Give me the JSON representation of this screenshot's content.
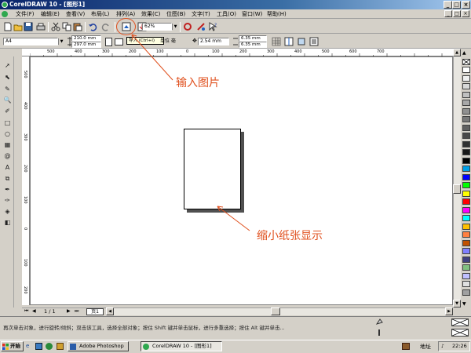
{
  "window": {
    "title": "CorelDRAW 10 - [图形1]",
    "min": "_",
    "max": "□",
    "close": "×",
    "doc_min": "_",
    "doc_max": "□",
    "doc_close": "×"
  },
  "menu": [
    "文件(F)",
    "编辑(E)",
    "查看(V)",
    "布局(L)",
    "排列(A)",
    "效果(C)",
    "位图(B)",
    "文字(T)",
    "工具(O)",
    "窗口(W)",
    "帮助(H)"
  ],
  "toolbar": {
    "zoom": "62%"
  },
  "property_bar": {
    "page_size": "A4",
    "width": "210.0 mm",
    "height": "297.0 mm",
    "units": "单位 毫米",
    "nudge": "2.54 mm",
    "dup_x": "6.35 mm",
    "dup_y": "6.35 mm"
  },
  "tooltip": "导入 (Ctrl+I)",
  "ruler_h": [
    "500",
    "400",
    "300",
    "200",
    "100",
    "0",
    "100",
    "200",
    "300",
    "400",
    "500",
    "600",
    "700"
  ],
  "ruler_v": [
    "500",
    "400",
    "300",
    "200",
    "100",
    "0",
    "100",
    "200"
  ],
  "page_nav": {
    "pos": "1 / 1",
    "tab": "页1"
  },
  "status": {
    "hint": "再次单击对象，进行旋转/倾斜；双击该工具，选择全部对象；按住 Shift 键并单击鼠标，进行多重选择；按住 Alt 键并单击..."
  },
  "annotations": {
    "import_label": "输入图片",
    "shrink_label": "缩小纸张显示"
  },
  "taskbar": {
    "start": "开始",
    "photoshop": "Adobe Photoshop",
    "corel": "CorelDRAW 10 - [图形1]",
    "address": "地址",
    "clock": "22:26"
  },
  "colors": {
    "accent": "#e0501e",
    "palette": [
      "#ffffff",
      "#f0f0f0",
      "#d8d8d8",
      "#c0c0c0",
      "#a8a8a8",
      "#909090",
      "#787878",
      "#606060",
      "#484848",
      "#303030",
      "#181818",
      "#000000",
      "#00a0e8",
      "#0000ff",
      "#00ff00",
      "#ffff00",
      "#ff0000",
      "#ff00ff",
      "#00ffff",
      "#ffc000",
      "#ff8040",
      "#c05000",
      "#8080ff",
      "#404080",
      "#80c080",
      "#c0c0ff",
      "#e0e0e0",
      "#a0a0a0"
    ]
  }
}
